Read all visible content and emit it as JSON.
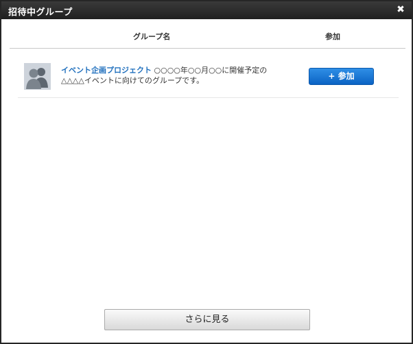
{
  "dialog": {
    "title": "招待中グループ",
    "close_icon": "close-icon",
    "close_glyph": "✖"
  },
  "table": {
    "headers": {
      "name": "グループ名",
      "join": "参加"
    },
    "rows": [
      {
        "avatar_icon": "group-avatar-icon",
        "name": "イベント企画プロジェクト",
        "description": " ○○○○年○○月○○に開催予定の△△△△イベントに向けてのグループです。",
        "join_label": "+ 参加",
        "join_button_color": "#0b63c4"
      }
    ]
  },
  "footer": {
    "more_label": "さらに見る"
  },
  "colors": {
    "titlebar": "#262626",
    "link": "#1f6fbd",
    "accent": "#1673d3"
  }
}
